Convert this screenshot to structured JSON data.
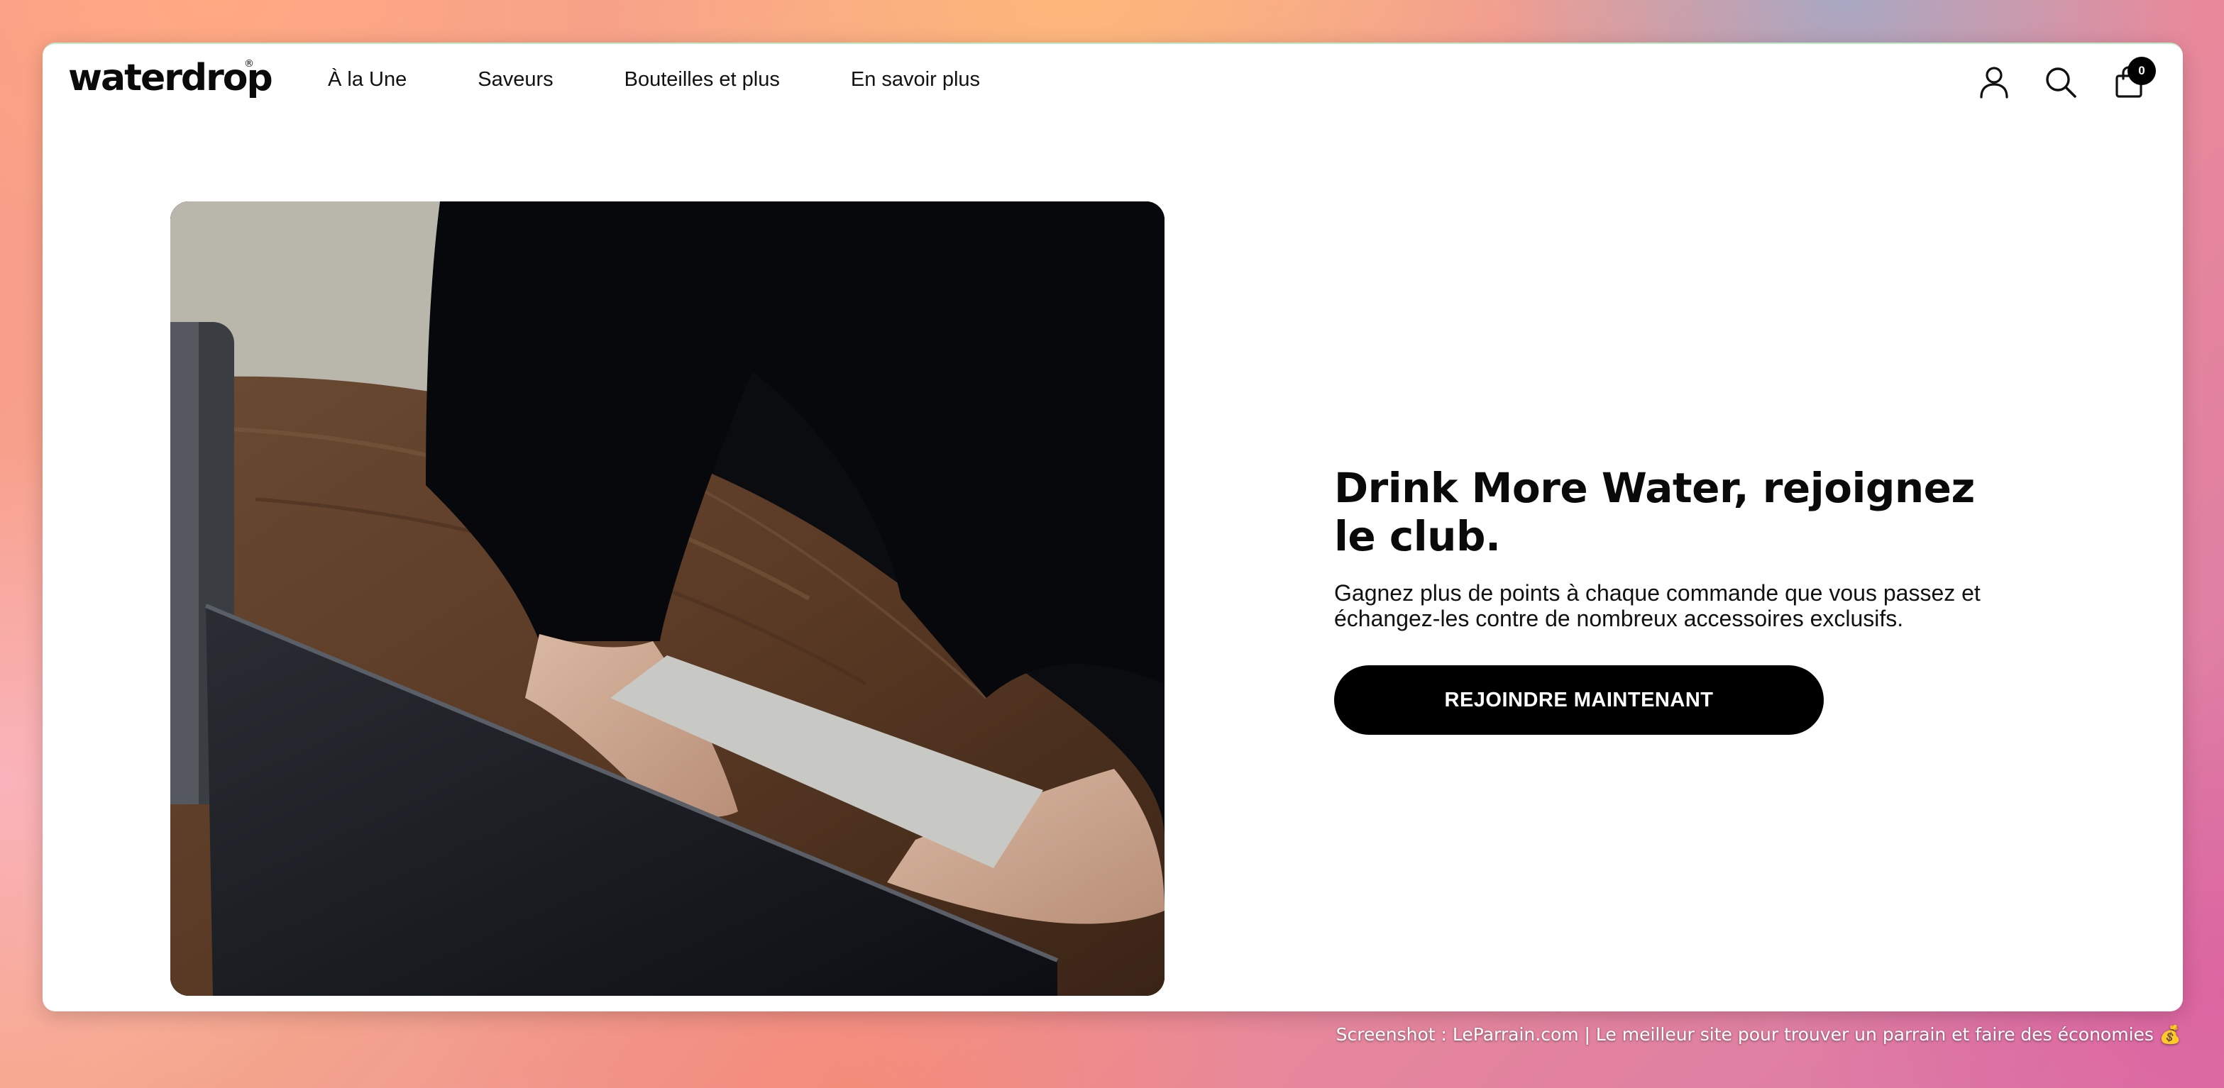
{
  "header": {
    "logo": "waterdrop",
    "logo_mark": "®",
    "nav": [
      {
        "label": "À la Une"
      },
      {
        "label": "Saveurs"
      },
      {
        "label": "Bouteilles et plus"
      },
      {
        "label": "En savoir plus"
      }
    ],
    "icons": {
      "account": "user-icon",
      "search": "search-icon",
      "cart": "shopping-bag-icon"
    },
    "cart_count": "0"
  },
  "hero": {
    "image": "photo-person-typing-on-laptop",
    "title": "Drink More Water, rejoignez le club.",
    "text": "Gagnez plus de points à chaque commande que vous passez et échangez-les contre de nombreux accessoires exclusifs.",
    "cta_label": "REJOINDRE MAINTENANT"
  },
  "caption": "Screenshot : LeParrain.com | Le meilleur site pour trouver un parrain et faire des économies 💰"
}
